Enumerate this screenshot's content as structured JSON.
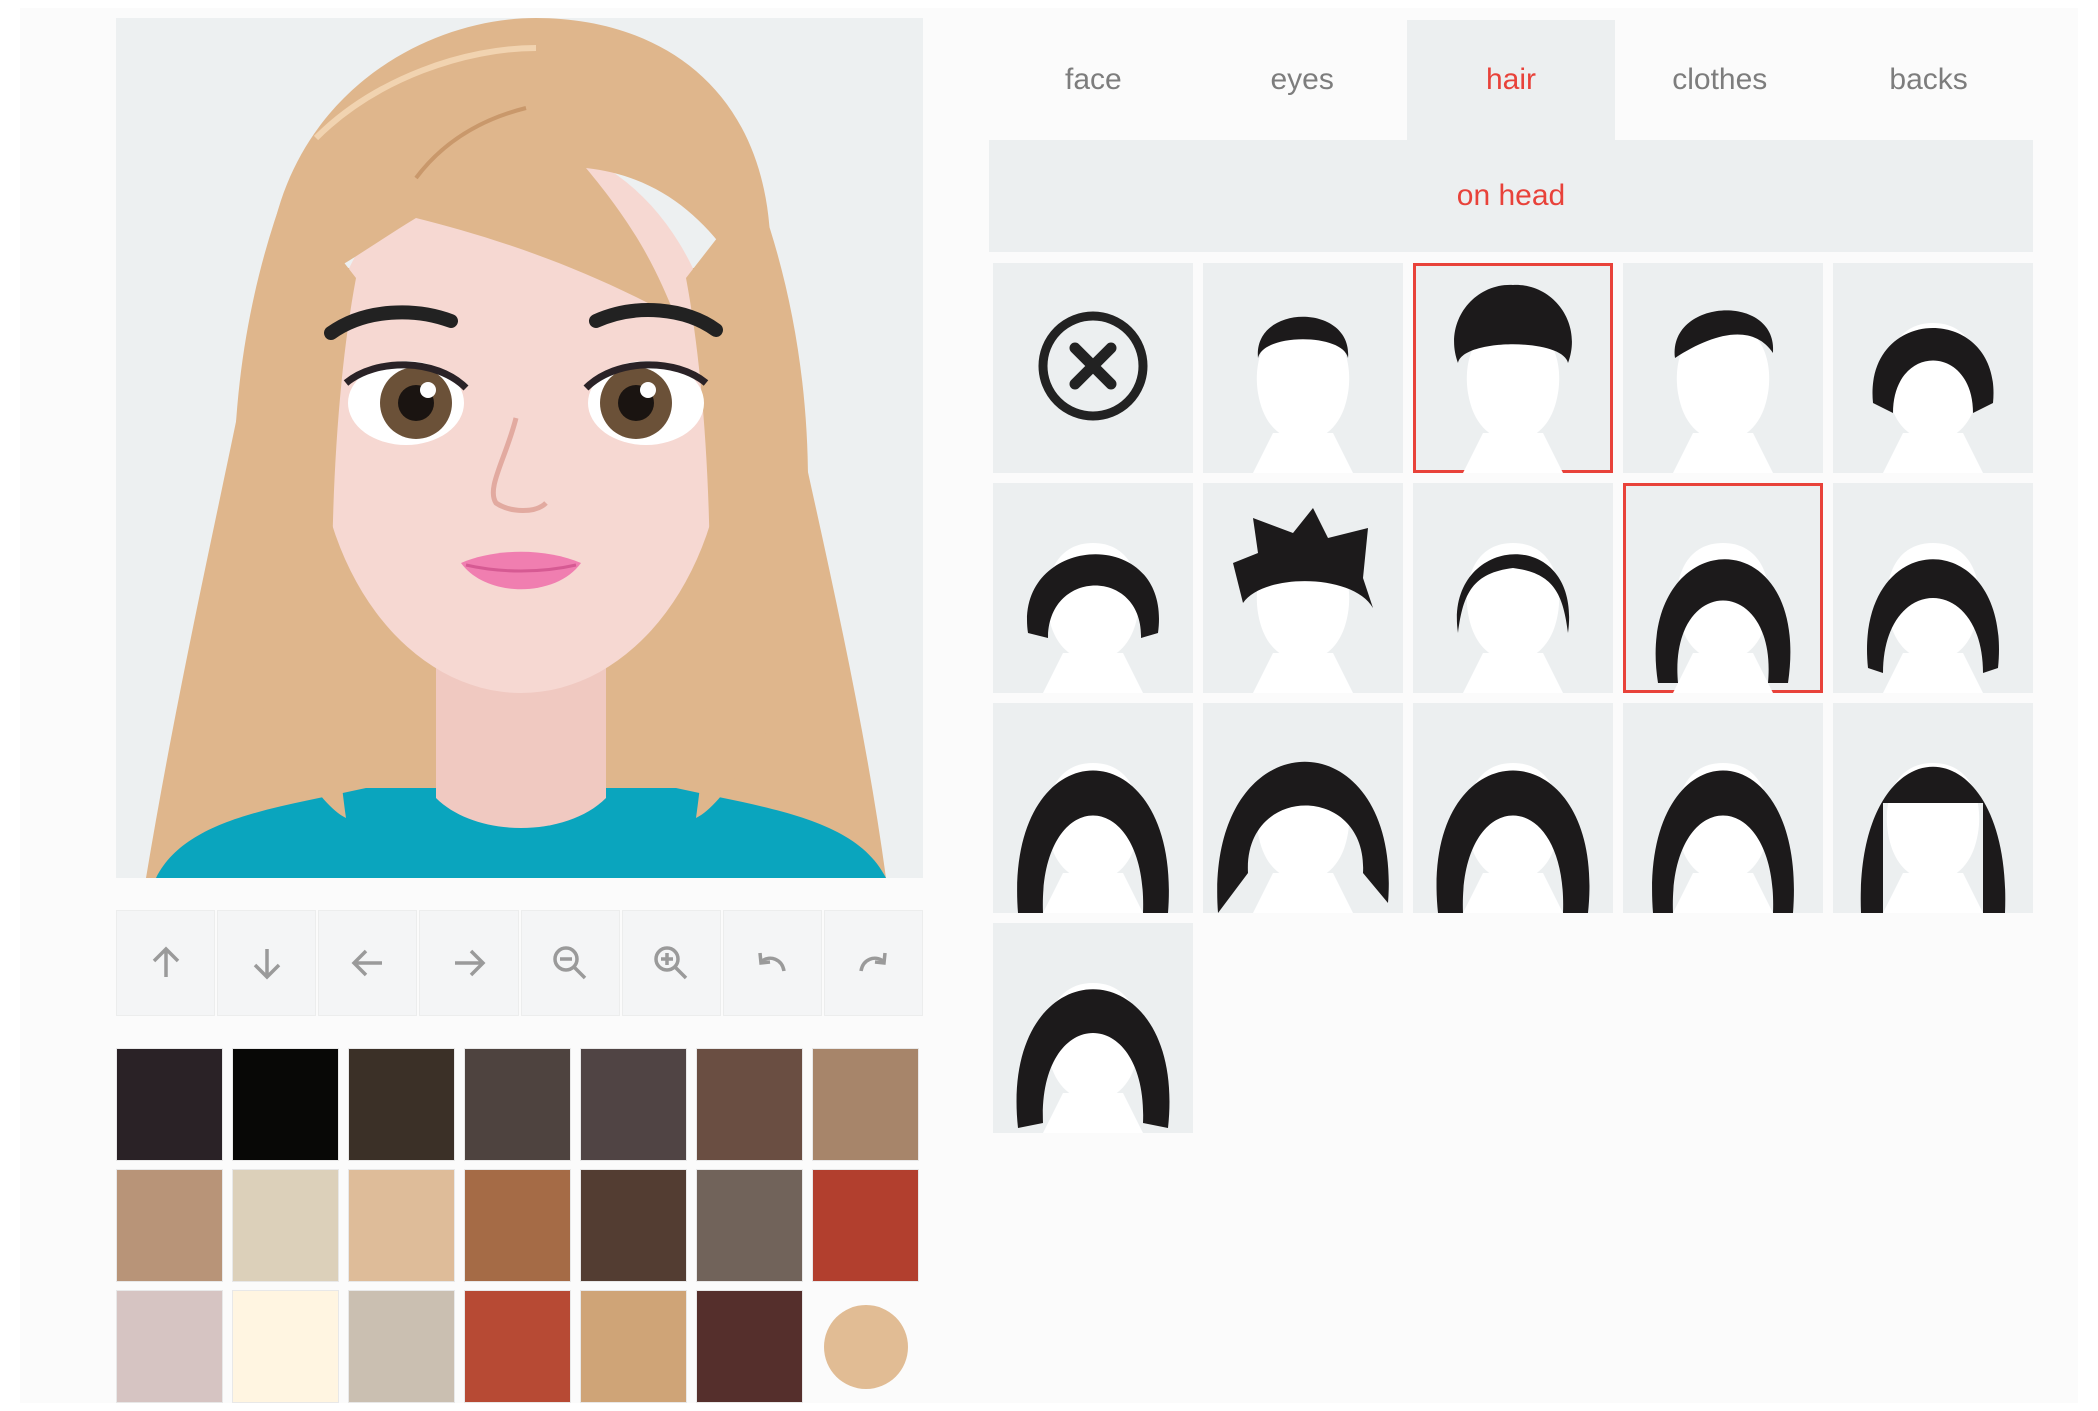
{
  "tabs": [
    {
      "label": "face"
    },
    {
      "label": "eyes"
    },
    {
      "label": "hair",
      "active": true
    },
    {
      "label": "clothes"
    },
    {
      "label": "backs"
    }
  ],
  "subtab": {
    "label": "on head"
  },
  "toolbar": [
    {
      "icon": "arrow-up-icon"
    },
    {
      "icon": "arrow-down-icon"
    },
    {
      "icon": "arrow-left-icon"
    },
    {
      "icon": "arrow-right-icon"
    },
    {
      "icon": "zoom-out-icon"
    },
    {
      "icon": "zoom-in-icon"
    },
    {
      "icon": "undo-icon"
    },
    {
      "icon": "redo-icon"
    }
  ],
  "palette": [
    "#2a2226",
    "#080806",
    "#3b3027",
    "#4e433f",
    "#504444",
    "#6a4e42",
    "#a7856a",
    "#b89478",
    "#dcd0ba",
    "#debc99",
    "#a56b46",
    "#533d32",
    "#71635a",
    "#b23f2e",
    "#d6c4c2",
    "#fff5e1",
    "#cabfb1",
    "#b74a34",
    "#cfa477",
    "#552f2c"
  ],
  "current_color": "#e1bc94",
  "hair_styles": [
    {
      "name": "none"
    },
    {
      "name": "short-crop"
    },
    {
      "name": "curly-short",
      "selected": true
    },
    {
      "name": "side-sweep"
    },
    {
      "name": "bob"
    },
    {
      "name": "wavy-short"
    },
    {
      "name": "spiky"
    },
    {
      "name": "curly-bangs"
    },
    {
      "name": "shoulder-length",
      "selected": true
    },
    {
      "name": "bob-bangs"
    },
    {
      "name": "long-straight"
    },
    {
      "name": "voluminous-curls"
    },
    {
      "name": "long-wavy"
    },
    {
      "name": "long-sleek"
    },
    {
      "name": "long-blunt-bangs"
    },
    {
      "name": "long-layered"
    }
  ],
  "colors": {
    "accent": "#e8423a",
    "hair_preview": "#dfb68c",
    "shirt": "#0aa5be",
    "skin": "#f6d8d2"
  }
}
